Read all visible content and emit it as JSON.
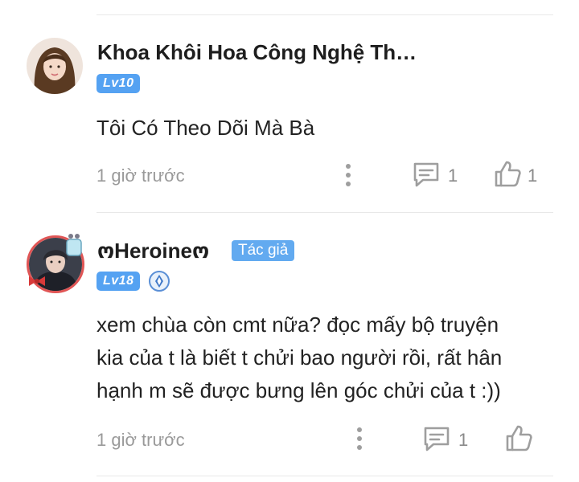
{
  "comments": [
    {
      "author": "Khoa Khôi Hoa Công Nghệ Th…",
      "level": "Lv10",
      "text_lines": [
        "Tôi Có Theo Dõi Mà Bà"
      ],
      "time": "1 giờ trước",
      "reply_count": "1",
      "like_count": "1"
    },
    {
      "author": "ოHeroineო",
      "author_badge": "Tác giả",
      "level": "Lv18",
      "text_lines": [
        "xem chùa còn cmt nữa? đọc mấy bộ truyện",
        "kia của t là biết t chửi bao người rồi, rất hân",
        "hạnh m sẽ được bưng lên góc chửi của t :))"
      ],
      "time": "1 giờ trước",
      "reply_count": "1"
    }
  ],
  "colors": {
    "level_badge": "#55a2f2",
    "author_badge": "#62aaf0",
    "icon_gray": "#9e9e9e"
  },
  "icons": [
    "more-vertical-icon",
    "comment-icon",
    "thumbs-up-icon",
    "achievement-medal-icon"
  ]
}
